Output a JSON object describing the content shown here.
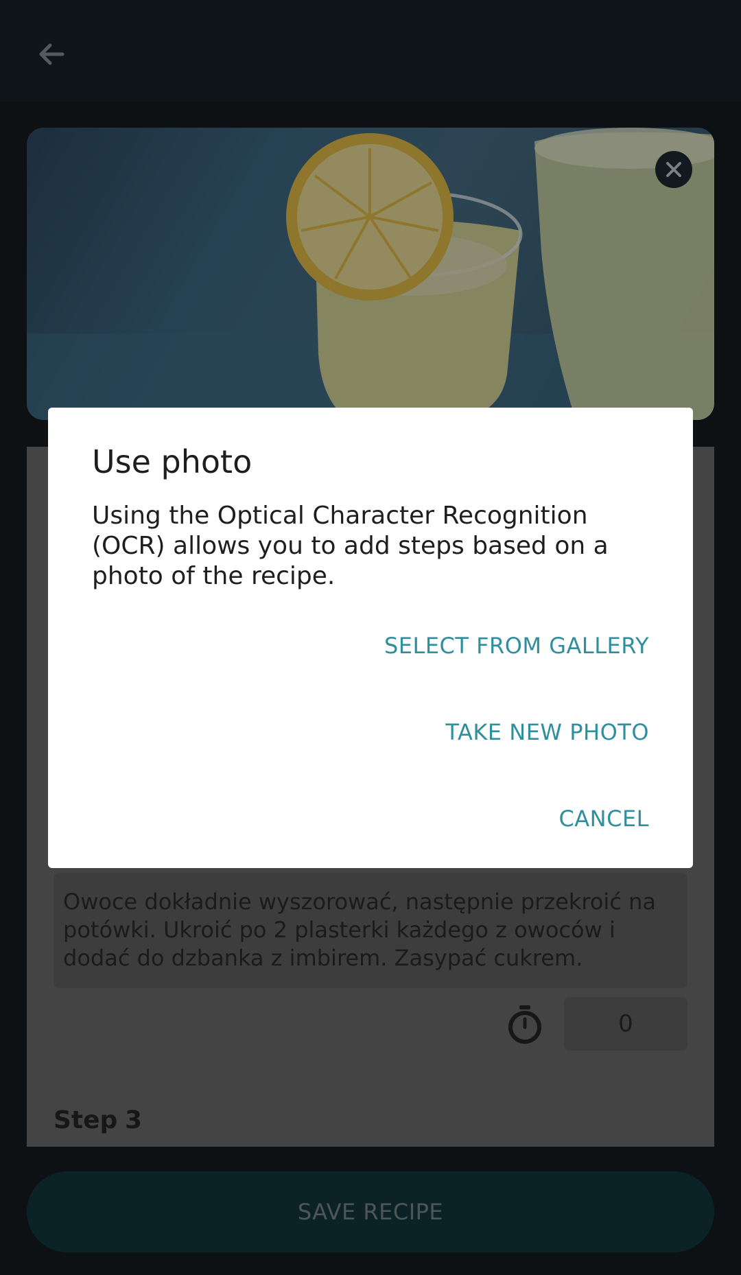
{
  "app": {
    "topbar": {
      "back_icon": "arrow-left-icon"
    },
    "photo": {
      "close_icon": "close-icon"
    },
    "step_current": {
      "text": "Owoce dokładnie wyszorować, następnie przekroić na potówki. Ukroić po 2 plasterki każdego z owoców i dodać do dzbanka z imbirem. Zasypać cukrem.",
      "timer_icon": "stopwatch-icon",
      "timer_value": "0"
    },
    "step_next": {
      "label": "Step",
      "number": "3"
    },
    "save_button": "SAVE RECIPE"
  },
  "dialog": {
    "title": "Use photo",
    "message": "Using the Optical Character Recognition (OCR) allows you to add steps based on a photo of the recipe.",
    "actions": {
      "select_gallery": "SELECT FROM GALLERY",
      "take_photo": "TAKE NEW PHOTO",
      "cancel": "CANCEL"
    },
    "accent_color": "#2f8f9d"
  }
}
